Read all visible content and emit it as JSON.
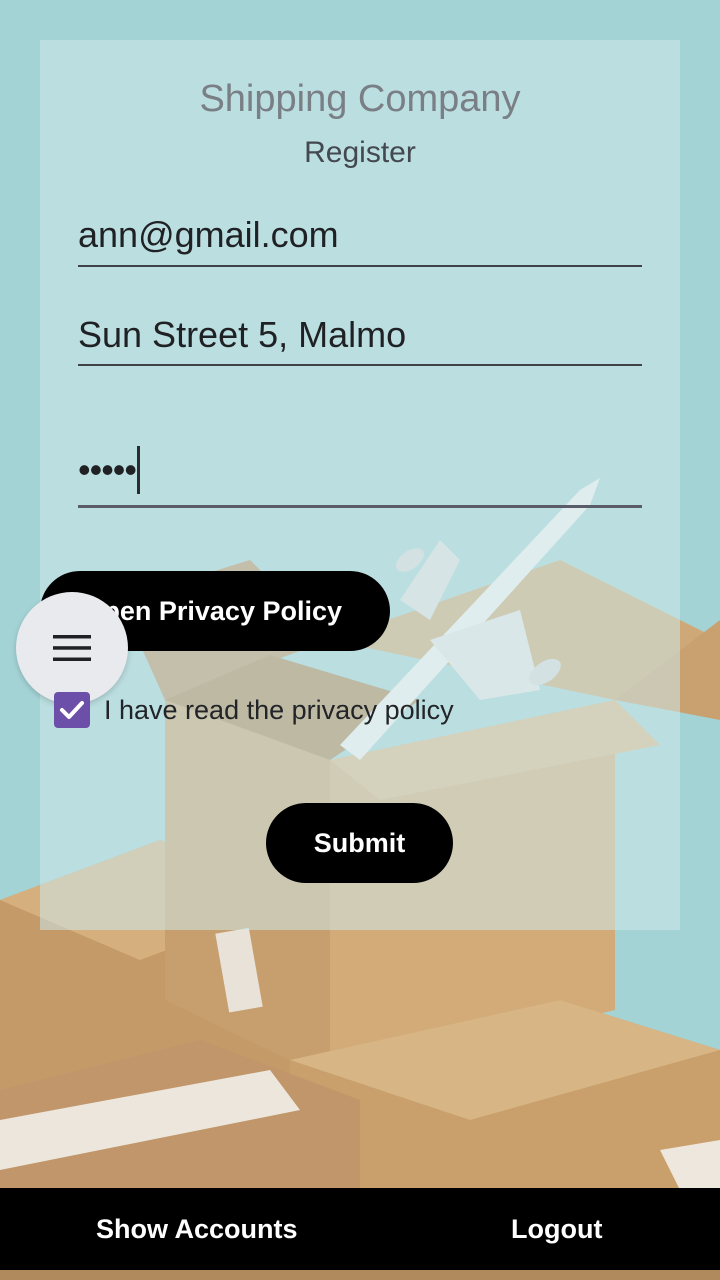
{
  "app": {
    "title": "Shipping Company",
    "subtitle": "Register"
  },
  "form": {
    "email_value": "ann@gmail.com",
    "address_value": "Sun Street 5, Malmo",
    "password_masked": "•••••",
    "privacy_button_label": "Open Privacy Policy",
    "privacy_checkbox_label": "I have read the privacy policy",
    "privacy_checked": true,
    "submit_label": "Submit"
  },
  "bottom_nav": {
    "show_accounts_label": "Show Accounts",
    "logout_label": "Logout"
  },
  "icons": {
    "menu": "hamburger-menu-icon",
    "checkbox": "checkmark-icon"
  },
  "colors": {
    "background": "#a4d3d6",
    "checkbox_accent": "#6c4fa8",
    "button": "#000000",
    "button_text": "#ffffff"
  }
}
